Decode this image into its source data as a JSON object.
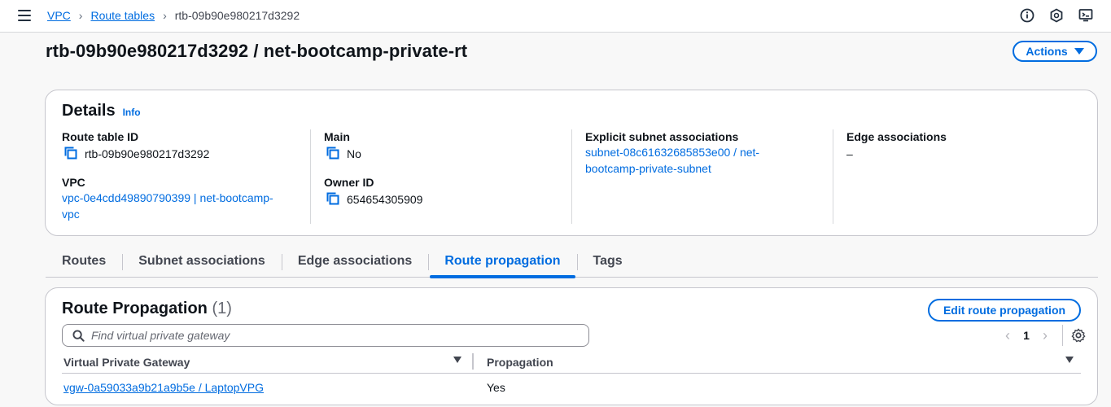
{
  "breadcrumbs": {
    "items": [
      {
        "label": "VPC"
      },
      {
        "label": "Route tables"
      }
    ],
    "current": "rtb-09b90e980217d3292",
    "separator": "›"
  },
  "page": {
    "title": "rtb-09b90e980217d3292 / net-bootcamp-private-rt",
    "actions_label": "Actions"
  },
  "details": {
    "title": "Details",
    "info_label": "Info",
    "route_table_id": {
      "label": "Route table ID",
      "value": "rtb-09b90e980217d3292"
    },
    "vpc": {
      "label": "VPC",
      "value_line1": "vpc-0e4cdd49890790399 | net-bootcamp-",
      "value_line2": "vpc"
    },
    "main": {
      "label": "Main",
      "value": "No"
    },
    "owner_id": {
      "label": "Owner ID",
      "value": "654654305909"
    },
    "explicit_subnet": {
      "label": "Explicit subnet associations",
      "value_line1": "subnet-08c61632685853e00 / net-",
      "value_line2": "bootcamp-private-subnet"
    },
    "edge": {
      "label": "Edge associations",
      "value": "–"
    }
  },
  "tabs": [
    {
      "label": "Routes",
      "active": false
    },
    {
      "label": "Subnet associations",
      "active": false
    },
    {
      "label": "Edge associations",
      "active": false
    },
    {
      "label": "Route propagation",
      "active": true
    },
    {
      "label": "Tags",
      "active": false
    }
  ],
  "route_propagation": {
    "title": "Route Propagation",
    "count": "(1)",
    "edit_label": "Edit route propagation",
    "search_placeholder": "Find virtual private gateway",
    "pagination": {
      "page": "1",
      "prev": "‹",
      "next": "›"
    },
    "columns": [
      "Virtual Private Gateway",
      "Propagation"
    ],
    "rows": [
      {
        "gateway": "vgw-0a59033a9b21a9b5e / LaptopVPG",
        "propagation": "Yes"
      }
    ]
  },
  "colors": {
    "accent": "#006ce0",
    "text": "#0f141a",
    "border": "#c6c6cd",
    "background": "#f8f8f8"
  },
  "icons": [
    "menu-icon",
    "info-icon",
    "notifications-icon",
    "cloudshell-icon",
    "copy-icon",
    "search-icon",
    "settings-icon",
    "caret-down-icon",
    "sort-icon"
  ]
}
